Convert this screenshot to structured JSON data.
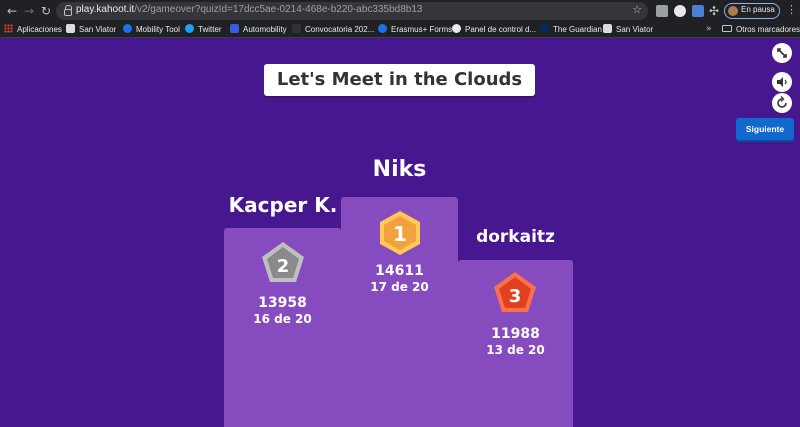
{
  "browser": {
    "url_host": "play.kahoot.it",
    "url_path": "/v2/gameover?quizId=17dcc5ae-0214-468e-b220-abc335bd8b13",
    "profile_label": "En pausa"
  },
  "bookmarks": {
    "items": [
      {
        "label": "Aplicaciones"
      },
      {
        "label": "San Viator"
      },
      {
        "label": "Mobility Tool"
      },
      {
        "label": "Twitter"
      },
      {
        "label": "Automobility"
      },
      {
        "label": "Convocatoria 202..."
      },
      {
        "label": "Erasmus+ Forms"
      },
      {
        "label": "Panel de control d..."
      },
      {
        "label": "The Guardian"
      },
      {
        "label": "San Viator"
      }
    ],
    "other_label": "Otros marcadores"
  },
  "game": {
    "title": "Let's Meet in the Clouds",
    "next_label": "Siguiente",
    "podium": [
      {
        "rank": "1",
        "name": "Niks",
        "score": "14611",
        "correct": "17 de 20",
        "medal_color": "#f2a23c"
      },
      {
        "rank": "2",
        "name": "Kacper K.",
        "score": "13958",
        "correct": "16 de 20",
        "medal_color": "#8a8a8a"
      },
      {
        "rank": "3",
        "name": "dorkaitz",
        "score": "11988",
        "correct": "13 de 20",
        "medal_color": "#e2411f"
      }
    ]
  },
  "colors": {
    "background": "#46178f",
    "podium": "#864cbf",
    "button": "#1368ce"
  }
}
